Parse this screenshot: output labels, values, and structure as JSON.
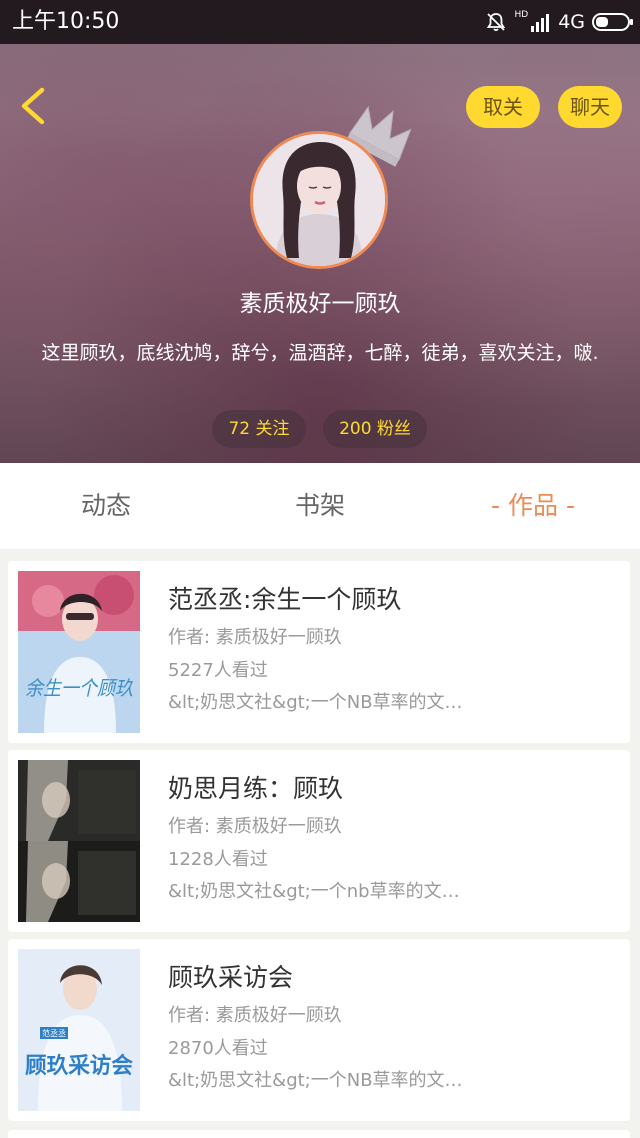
{
  "status_bar": {
    "time": "上午10:50",
    "network": "4G",
    "hd": "HD"
  },
  "header": {
    "back_icon": "chevron-left-icon",
    "unfollow_label": "取关",
    "chat_label": "聊天",
    "crown_icon": "crown-icon",
    "user_name": "素质极好一顾玖",
    "bio": "这里顾玖，底线沈鸠，辞兮，温酒辞，七醉，徒弟，喜欢关注，啵.",
    "following": "72 关注",
    "followers": "200 粉丝"
  },
  "colors": {
    "accent": "#ef8a55",
    "button_yellow": "#ffd92f",
    "stat_text": "#ffd92f"
  },
  "tabs": [
    {
      "label": "动态",
      "active": false
    },
    {
      "label": "书架",
      "active": false
    },
    {
      "label": "- 作品 -",
      "active": true
    }
  ],
  "works": [
    {
      "title": "范丞丞:余生一个顾玖",
      "author": "作者: 素质极好一顾玖",
      "views": "5227人看过",
      "description": "&lt;奶思文社&gt;一个NB草率的文…",
      "cover_text": "余生一个顾玖"
    },
    {
      "title": "奶思月练：顾玖",
      "author": "作者: 素质极好一顾玖",
      "views": "1228人看过",
      "description": "&lt;奶思文社&gt;一个nb草率的文…"
    },
    {
      "title": "顾玖采访会",
      "author": "作者: 素质极好一顾玖",
      "views": "2870人看过",
      "description": "&lt;奶思文社&gt;一个NB草率的文…",
      "cover_text": "顾玖采访会",
      "cover_badge": "范丞丞"
    }
  ]
}
